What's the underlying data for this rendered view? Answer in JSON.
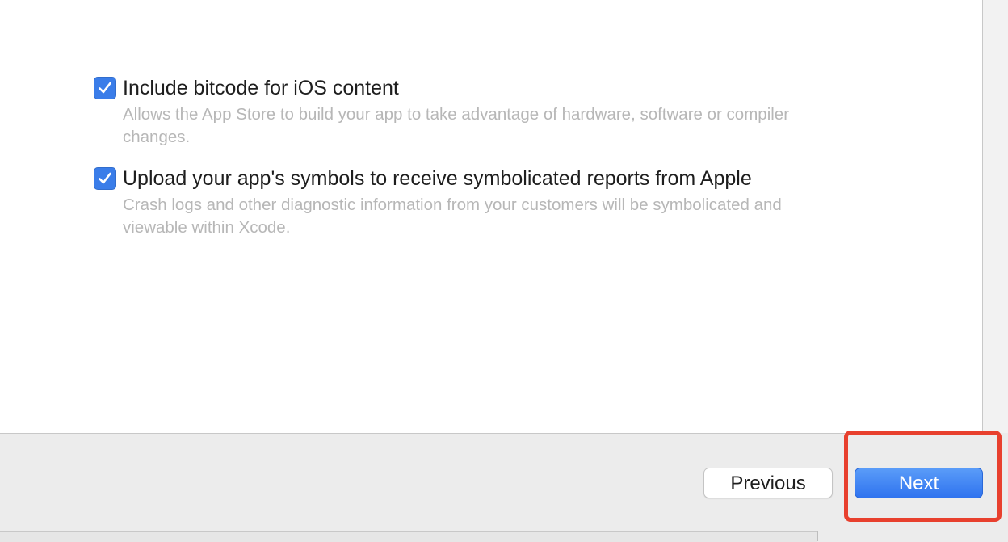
{
  "options": [
    {
      "title": "Include bitcode for iOS content",
      "description": "Allows the App Store to build your app to take advantage of hardware, software or compiler changes.",
      "checked": true
    },
    {
      "title": "Upload your app's symbols to receive symbolicated reports from Apple",
      "description": "Crash logs and other diagnostic information from your customers will be symbolicated and viewable within Xcode.",
      "checked": true
    }
  ],
  "buttons": {
    "previous_label": "Previous",
    "next_label": "Next"
  },
  "colors": {
    "checkbox": "#3a7de9",
    "primary_button": "#2f73ef",
    "highlight": "#e8402e"
  }
}
